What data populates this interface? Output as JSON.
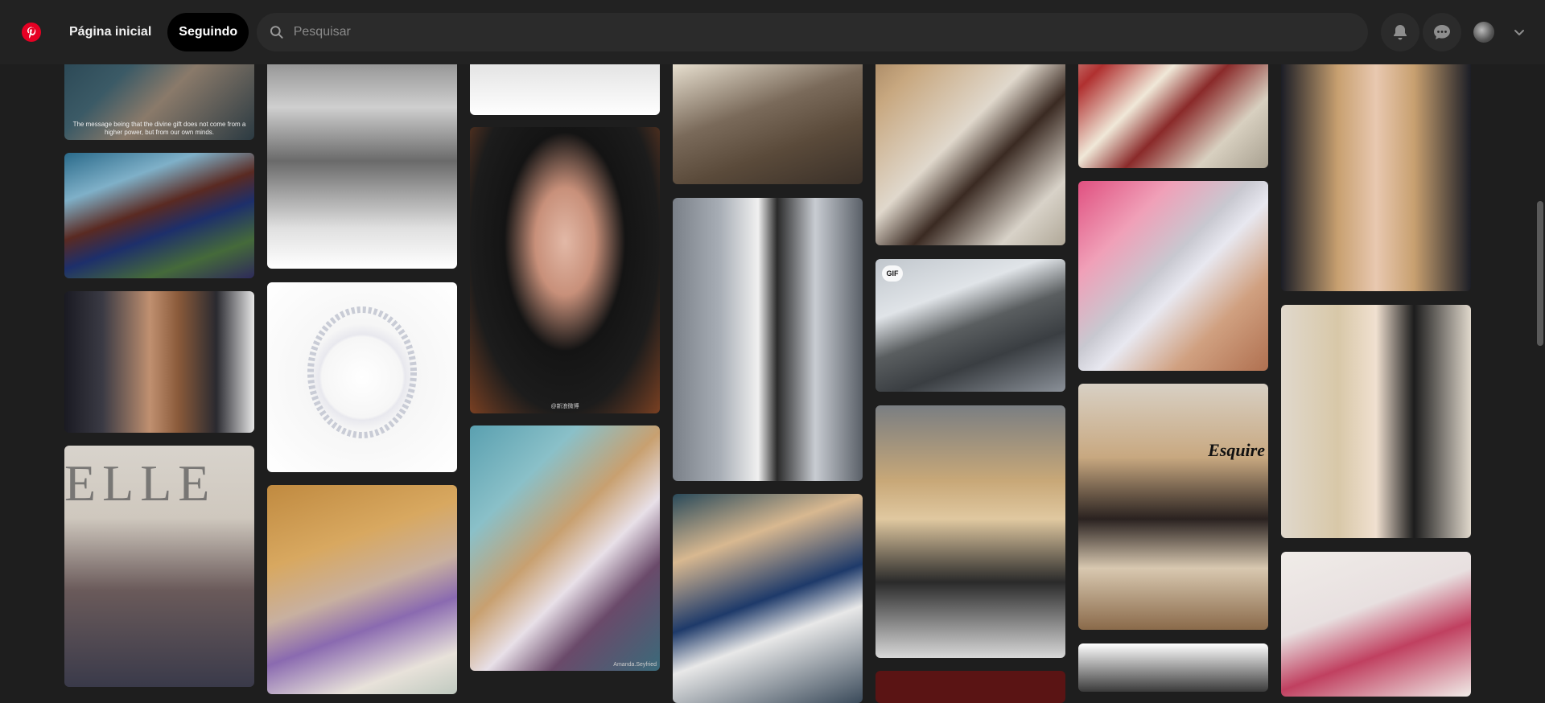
{
  "nav": {
    "home_label": "Página inicial",
    "following_label": "Seguindo"
  },
  "search": {
    "placeholder": "Pesquisar"
  },
  "pins": {
    "quote_caption": "The message being that the divine gift does not come from a higher power, but from our own minds.",
    "gif_badge": "GIF",
    "elle_text": "ELLE",
    "esquire_text": "Esquire",
    "watermark_1": "@新浪微博",
    "watermark_2": "Amanda.Seyfried"
  },
  "colors": {
    "brand": "#e60023",
    "topbar": "#222222",
    "background": "#1e1e1e"
  },
  "icons": [
    "pinterest-logo-icon",
    "search-icon",
    "bell-icon",
    "chat-icon",
    "avatar",
    "chevron-down-icon"
  ]
}
